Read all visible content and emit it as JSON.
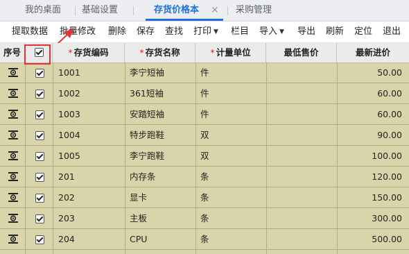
{
  "tabs": [
    {
      "label": "我的桌面"
    },
    {
      "label": "基础设置"
    },
    {
      "label": "存货价格本",
      "closable": true
    },
    {
      "label": "采购管理"
    }
  ],
  "active_tab_index": 2,
  "toolbar": {
    "extract": "提取数据",
    "batch_edit": "批量修改",
    "delete": "删除",
    "save": "保存",
    "find": "查找",
    "print": "打印",
    "columns": "栏目",
    "import": "导入",
    "export": "导出",
    "refresh": "刷新",
    "locate": "定位",
    "exit": "退出"
  },
  "table": {
    "headers": {
      "index": "序号",
      "code": "存货编码",
      "name": "存货名称",
      "unit": "计量单位",
      "min_price": "最低售价",
      "latest_price": "最新进价"
    },
    "rows": [
      {
        "code": "1001",
        "name": "李宁短袖",
        "unit": "件",
        "min_price": "",
        "latest_price": "50.00",
        "checked": true
      },
      {
        "code": "1002",
        "name": "361短袖",
        "unit": "件",
        "min_price": "",
        "latest_price": "60.00",
        "checked": true
      },
      {
        "code": "1003",
        "name": "安踏短袖",
        "unit": "件",
        "min_price": "",
        "latest_price": "60.00",
        "checked": true
      },
      {
        "code": "1004",
        "name": "特步跑鞋",
        "unit": "双",
        "min_price": "",
        "latest_price": "90.00",
        "checked": true
      },
      {
        "code": "1005",
        "name": "李宁跑鞋",
        "unit": "双",
        "min_price": "",
        "latest_price": "100.00",
        "checked": true
      },
      {
        "code": "201",
        "name": "内存条",
        "unit": "条",
        "min_price": "",
        "latest_price": "120.00",
        "checked": true
      },
      {
        "code": "202",
        "name": "显卡",
        "unit": "条",
        "min_price": "",
        "latest_price": "150.00",
        "checked": true
      },
      {
        "code": "203",
        "name": "主板",
        "unit": "条",
        "min_price": "",
        "latest_price": "300.00",
        "checked": true
      },
      {
        "code": "204",
        "name": "CPU",
        "unit": "条",
        "min_price": "",
        "latest_price": "500.00",
        "checked": true
      }
    ]
  },
  "colors": {
    "accent": "#1e6fd9",
    "row_bg": "#d9d4a9",
    "highlight": "#e53333",
    "required_star": "#e02020"
  }
}
